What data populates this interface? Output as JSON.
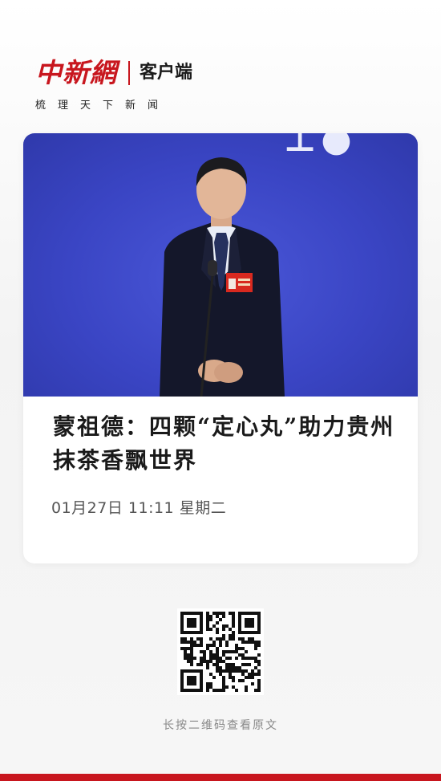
{
  "header": {
    "brand": "中新網",
    "brand_sub": "客户端",
    "tagline": "梳理天下新闻"
  },
  "article": {
    "photo_alt": "photo-of-speaker",
    "title": "蒙祖德：四颗“定心丸”助力贵州抹茶香飘世界",
    "datetime": "01月27日 11:11 星期二"
  },
  "footer": {
    "qr_caption": "长按二维码查看原文"
  },
  "colors": {
    "brand_red": "#c8161e",
    "photo_blue": "#3a45c4",
    "text_dark": "#1a1a1a",
    "text_gray": "#555555"
  },
  "icons": [
    "qr-code-icon"
  ]
}
